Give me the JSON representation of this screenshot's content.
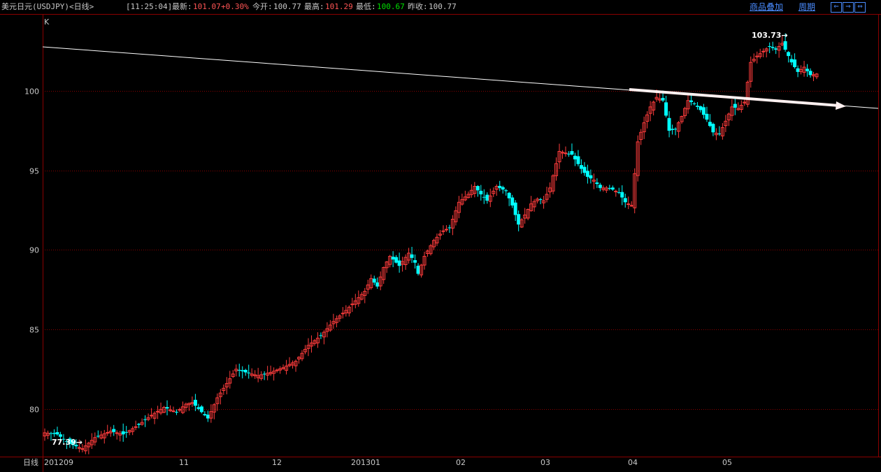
{
  "header": {
    "instrument": "美元日元(USDJPY)<日线>",
    "time": "[11:25:04]",
    "latest_label": "最新:",
    "latest_value": "101.07",
    "change": "+0.30%",
    "open_label": "今开:",
    "open_value": "100.77",
    "high_label": "最高:",
    "high_value": "101.29",
    "low_label": "最低:",
    "low_value": "100.67",
    "prev_close_label": "昨收:",
    "prev_close_value": "100.77",
    "overlay_link": "商品叠加",
    "period_link": "周期",
    "nav_buttons": [
      "⇐",
      "⇒",
      "⇔"
    ]
  },
  "chart_label": "K",
  "period_label": "日线",
  "colors": {
    "up": "#ff3c3c",
    "down": "#00ffff",
    "grid": "#8a0000",
    "background": "#000000",
    "trendline": "#ffffff"
  },
  "chart_data": {
    "type": "candlestick",
    "ylim": [
      77,
      104.8
    ],
    "y_ticks": [
      80,
      85,
      90,
      95,
      100
    ],
    "x_tick_labels": [
      "201209",
      "11",
      "12",
      "201301",
      "02",
      "03",
      "04",
      "05"
    ],
    "annotations": [
      {
        "label": "103.73",
        "type": "max"
      },
      {
        "label": "77.39",
        "type": "min"
      }
    ],
    "anchors": [
      [
        0,
        78.5
      ],
      [
        4,
        78.4
      ],
      [
        8,
        77.8
      ],
      [
        12,
        77.5
      ],
      [
        16,
        78.2
      ],
      [
        21,
        78.6
      ],
      [
        25,
        78.4
      ],
      [
        30,
        79.0
      ],
      [
        34,
        79.6
      ],
      [
        38,
        80.1
      ],
      [
        42,
        79.8
      ],
      [
        45,
        80.3
      ],
      [
        47,
        80.4
      ],
      [
        52,
        79.4
      ],
      [
        55,
        80.7
      ],
      [
        58,
        81.6
      ],
      [
        61,
        82.5
      ],
      [
        64,
        82.3
      ],
      [
        68,
        82.1
      ],
      [
        72,
        82.3
      ],
      [
        76,
        82.6
      ],
      [
        80,
        83.0
      ],
      [
        84,
        84.0
      ],
      [
        88,
        84.6
      ],
      [
        92,
        85.5
      ],
      [
        96,
        86.2
      ],
      [
        99,
        86.8
      ],
      [
        102,
        87.4
      ],
      [
        104,
        88.2
      ],
      [
        106,
        87.7
      ],
      [
        108,
        88.9
      ],
      [
        110,
        89.6
      ],
      [
        113,
        89.0
      ],
      [
        116,
        89.8
      ],
      [
        118,
        89.2
      ],
      [
        119,
        88.5
      ],
      [
        121,
        89.6
      ],
      [
        124,
        90.6
      ],
      [
        127,
        91.2
      ],
      [
        129,
        91.4
      ],
      [
        132,
        93.0
      ],
      [
        135,
        93.5
      ],
      [
        137,
        94.0
      ],
      [
        139,
        93.5
      ],
      [
        141,
        93.1
      ],
      [
        144,
        94.0
      ],
      [
        147,
        93.7
      ],
      [
        149,
        92.8
      ],
      [
        151,
        91.6
      ],
      [
        153,
        92.2
      ],
      [
        155,
        92.9
      ],
      [
        157,
        93.2
      ],
      [
        159,
        93.1
      ],
      [
        161,
        93.9
      ],
      [
        164,
        96.2
      ],
      [
        166,
        96.1
      ],
      [
        168,
        96.0
      ],
      [
        171,
        95.1
      ],
      [
        173,
        94.6
      ],
      [
        175,
        94.4
      ],
      [
        177,
        93.9
      ],
      [
        179,
        93.9
      ],
      [
        181,
        93.8
      ],
      [
        183,
        93.6
      ],
      [
        185,
        93.0
      ],
      [
        187,
        92.8
      ],
      [
        189,
        96.8
      ],
      [
        191,
        98.0
      ],
      [
        193,
        99.0
      ],
      [
        195,
        99.6
      ],
      [
        197,
        99.4
      ],
      [
        199,
        97.5
      ],
      [
        201,
        97.6
      ],
      [
        203,
        98.4
      ],
      [
        205,
        99.4
      ],
      [
        207,
        99.2
      ],
      [
        209,
        98.8
      ],
      [
        211,
        98.2
      ],
      [
        213,
        97.4
      ],
      [
        215,
        97.3
      ],
      [
        217,
        98.1
      ],
      [
        219,
        99.0
      ],
      [
        221,
        98.9
      ],
      [
        223,
        99.3
      ],
      [
        225,
        101.8
      ],
      [
        227,
        102.2
      ],
      [
        229,
        102.5
      ],
      [
        231,
        102.8
      ],
      [
        233,
        102.6
      ],
      [
        235,
        103.0
      ],
      [
        236,
        102.6
      ],
      [
        238,
        101.8
      ],
      [
        240,
        101.2
      ],
      [
        242,
        101.5
      ],
      [
        244,
        101.0
      ],
      [
        246,
        101.07
      ]
    ]
  }
}
